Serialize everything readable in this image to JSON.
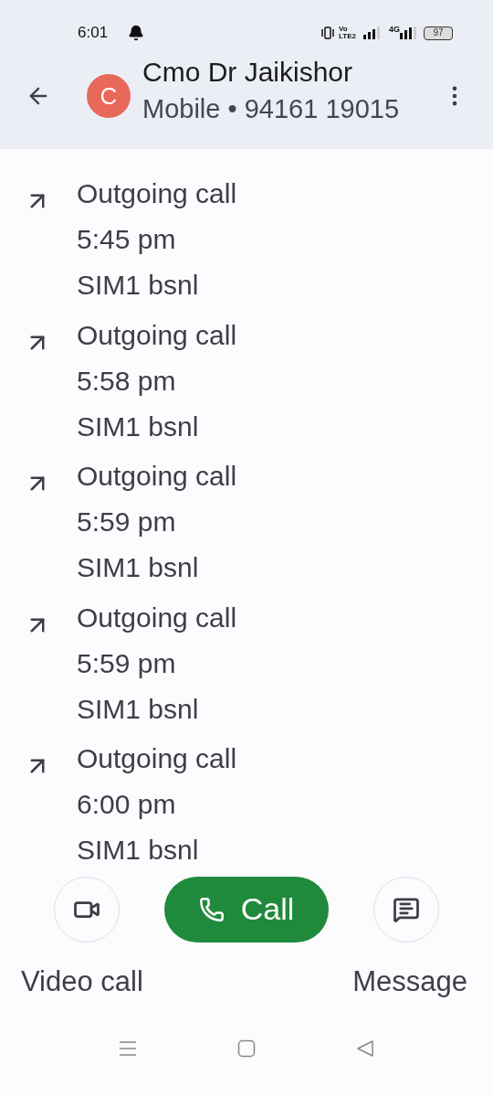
{
  "status_bar": {
    "time": "6:01",
    "volte_top": "Vo",
    "volte_bottom": "LTE2",
    "network": "4G",
    "battery": "97"
  },
  "header": {
    "avatar_letter": "C",
    "name": "Cmo Dr Jaikishor",
    "subtitle": "Mobile • 94161 19015"
  },
  "calls": [
    {
      "kind": "outgoing",
      "type": "Outgoing call",
      "time": "5:45 pm",
      "sim": "SIM1 bsnl"
    },
    {
      "kind": "outgoing",
      "type": "Outgoing call",
      "time": "5:58 pm",
      "sim": "SIM1 bsnl"
    },
    {
      "kind": "outgoing",
      "type": "Outgoing call",
      "time": "5:59 pm",
      "sim": "SIM1 bsnl"
    },
    {
      "kind": "outgoing",
      "type": "Outgoing call",
      "time": "5:59 pm",
      "sim": "SIM1 bsnl"
    },
    {
      "kind": "outgoing",
      "type": "Outgoing call",
      "time": "6:00 pm",
      "sim": "SIM1 bsnl"
    }
  ],
  "actions": {
    "call": "Call",
    "video": "Video call",
    "message": "Message"
  }
}
